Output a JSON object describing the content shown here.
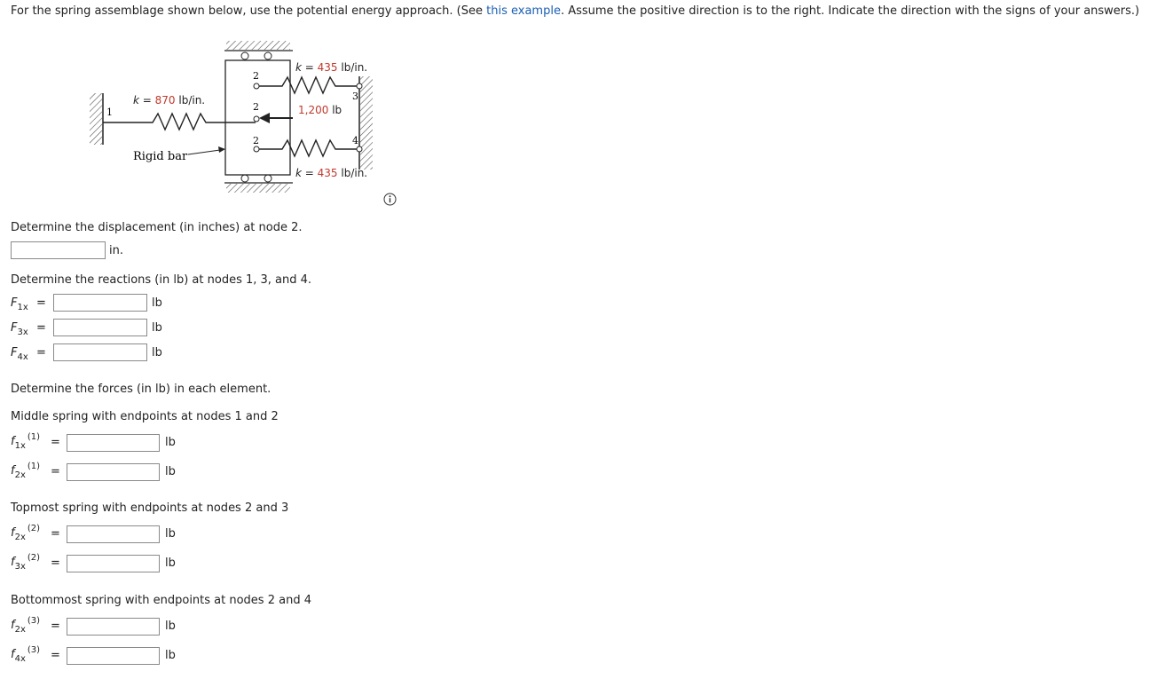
{
  "intro": {
    "before": "For the spring assemblage shown below, use the potential energy approach. (See ",
    "link": "this example",
    "after": ". Assume the positive direction is to the right. Indicate the direction with the signs of your answers.)"
  },
  "figure": {
    "k_left_value": "870",
    "k_left_unit": "lb/in.",
    "k_top_value": "435",
    "k_top_unit": "lb/in.",
    "k_bottom_value": "435",
    "k_bottom_unit": "lb/in.",
    "k_symbol": "k",
    "force_value": "1,200",
    "force_unit": "lb",
    "rigid_bar_label": "Rigid bar",
    "node_labels": [
      "1",
      "2",
      "2",
      "2",
      "3",
      "4"
    ]
  },
  "q1": {
    "prompt": "Determine the displacement (in inches) at node 2.",
    "unit": "in.",
    "value": ""
  },
  "q2": {
    "prompt": "Determine the reactions (in lb) at nodes 1, 3, and 4.",
    "rows": [
      {
        "sym": "F",
        "sub": "1x",
        "eq": "=",
        "unit": "lb",
        "value": ""
      },
      {
        "sym": "F",
        "sub": "3x",
        "eq": "=",
        "unit": "lb",
        "value": ""
      },
      {
        "sym": "F",
        "sub": "4x",
        "eq": "=",
        "unit": "lb",
        "value": ""
      }
    ]
  },
  "q3": {
    "prompt": "Determine the forces (in lb) in each element.",
    "groups": [
      {
        "heading": "Middle spring with endpoints at nodes 1 and 2",
        "rows": [
          {
            "sym": "f",
            "sub": "1x",
            "sup": "(1)",
            "eq": "=",
            "unit": "lb",
            "value": ""
          },
          {
            "sym": "f",
            "sub": "2x",
            "sup": "(1)",
            "eq": "=",
            "unit": "lb",
            "value": ""
          }
        ]
      },
      {
        "heading": "Topmost spring with endpoints at nodes 2 and 3",
        "rows": [
          {
            "sym": "f",
            "sub": "2x",
            "sup": "(2)",
            "eq": "=",
            "unit": "lb",
            "value": ""
          },
          {
            "sym": "f",
            "sub": "3x",
            "sup": "(2)",
            "eq": "=",
            "unit": "lb",
            "value": ""
          }
        ]
      },
      {
        "heading": "Bottommost spring with endpoints at nodes 2 and 4",
        "rows": [
          {
            "sym": "f",
            "sub": "2x",
            "sup": "(3)",
            "eq": "=",
            "unit": "lb",
            "value": ""
          },
          {
            "sym": "f",
            "sub": "4x",
            "sup": "(3)",
            "eq": "=",
            "unit": "lb",
            "value": ""
          }
        ]
      }
    ]
  },
  "colors": {
    "link": "#1a5fb4",
    "given_value": "#c0392b"
  },
  "icons": {
    "info": "info-circle-icon"
  }
}
